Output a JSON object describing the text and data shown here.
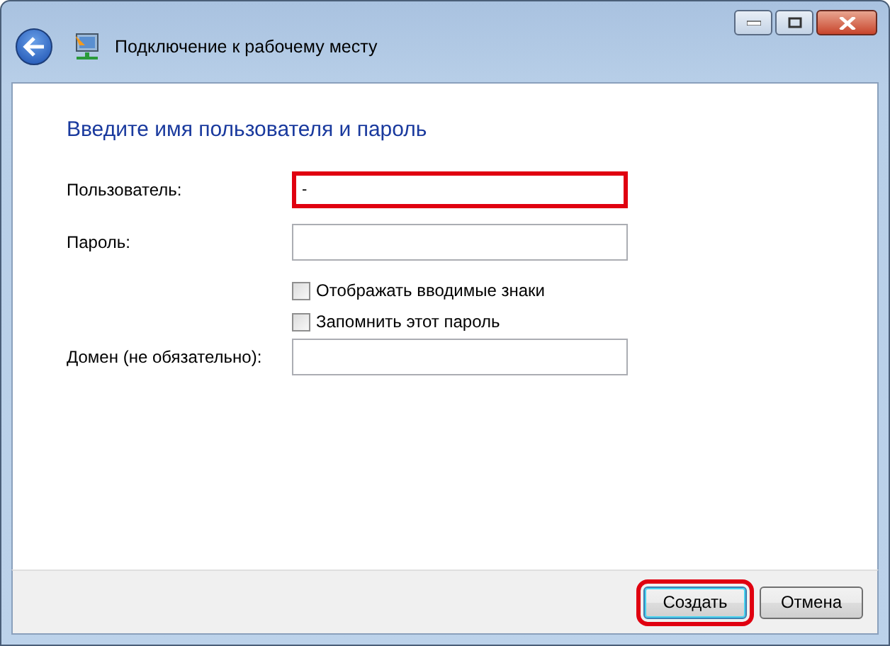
{
  "window": {
    "title": "Подключение к рабочему месту"
  },
  "heading": "Введите имя пользователя и пароль",
  "rows": [
    {
      "kind": "field",
      "label": "Пользователь:",
      "value": "-",
      "highlighted": true
    },
    {
      "kind": "field",
      "label": "Пароль:",
      "highlighted": false
    },
    {
      "kind": "checkbox",
      "label": "Отображать вводимые знаки",
      "checked": false
    },
    {
      "kind": "checkbox",
      "label": "Запомнить этот пароль",
      "checked": false
    },
    {
      "kind": "field",
      "label": "Домен (не обязательно):",
      "highlighted": false
    }
  ],
  "buttons": [
    {
      "label": "Создать",
      "default": true,
      "highlighted": true
    },
    {
      "label": "Отмена",
      "default": false,
      "highlighted": false
    }
  ]
}
